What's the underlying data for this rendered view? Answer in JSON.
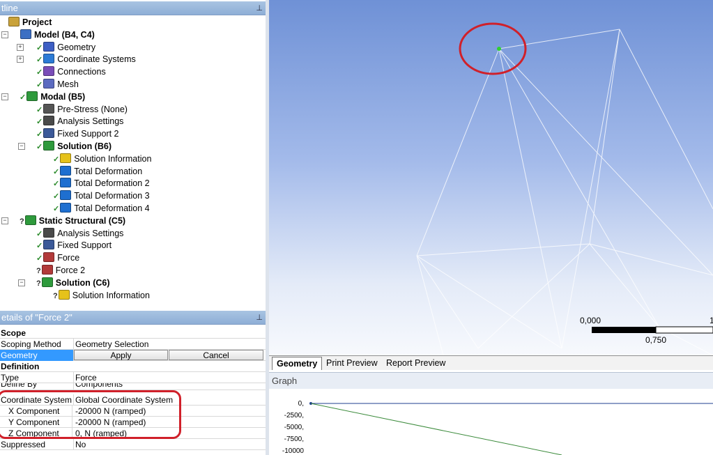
{
  "outline": {
    "title": "tline",
    "items": [
      {
        "label": "Project",
        "level": 0,
        "bold": true,
        "icon": "project-icon"
      },
      {
        "label": "Model (B4, C4)",
        "level": 1,
        "bold": true,
        "icon": "model-icon"
      },
      {
        "label": "Geometry",
        "level": 2,
        "icon": "geometry-icon"
      },
      {
        "label": "Coordinate Systems",
        "level": 2,
        "icon": "coordinate-icon"
      },
      {
        "label": "Connections",
        "level": 2,
        "icon": "connections-icon"
      },
      {
        "label": "Mesh",
        "level": 2,
        "icon": "mesh-icon"
      },
      {
        "label": "Modal (B5)",
        "level": 1,
        "bold": true,
        "icon": "modal-icon"
      },
      {
        "label": "Pre-Stress (None)",
        "level": 2,
        "icon": "prestress-icon"
      },
      {
        "label": "Analysis Settings",
        "level": 2,
        "icon": "analysis-settings-icon"
      },
      {
        "label": "Fixed Support 2",
        "level": 2,
        "icon": "fixed-support-icon"
      },
      {
        "label": "Solution (B6)",
        "level": 2,
        "bold": true,
        "icon": "solution-icon"
      },
      {
        "label": "Solution Information",
        "level": 3,
        "icon": "solution-info-icon"
      },
      {
        "label": "Total Deformation",
        "level": 3,
        "icon": "deformation-icon"
      },
      {
        "label": "Total Deformation 2",
        "level": 3,
        "icon": "deformation-icon"
      },
      {
        "label": "Total Deformation 3",
        "level": 3,
        "icon": "deformation-icon"
      },
      {
        "label": "Total Deformation 4",
        "level": 3,
        "icon": "deformation-icon"
      },
      {
        "label": "Static Structural (C5)",
        "level": 1,
        "bold": true,
        "icon": "static-structural-icon"
      },
      {
        "label": "Analysis Settings",
        "level": 2,
        "icon": "analysis-settings-icon"
      },
      {
        "label": "Fixed Support",
        "level": 2,
        "icon": "fixed-support-icon"
      },
      {
        "label": "Force",
        "level": 2,
        "icon": "force-icon"
      },
      {
        "label": "Force 2",
        "level": 2,
        "icon": "force-icon"
      },
      {
        "label": "Solution (C6)",
        "level": 2,
        "bold": true,
        "icon": "solution-icon"
      },
      {
        "label": "Solution Information",
        "level": 3,
        "icon": "solution-info-icon"
      }
    ]
  },
  "details": {
    "title": "etails of \"Force 2\"",
    "scope_header": "Scope",
    "scoping_method_key": "Scoping Method",
    "scoping_method_val": "Geometry Selection",
    "geometry_key": "Geometry",
    "apply_label": "Apply",
    "cancel_label": "Cancel",
    "definition_header": "Definition",
    "type_key": "Type",
    "type_val": "Force",
    "define_by_key": "Define By",
    "define_by_val": "Components",
    "coord_key": "Coordinate System",
    "coord_val": "Global Coordinate System",
    "x_key": "X Component",
    "x_val": "-20000 N  (ramped)",
    "y_key": "Y Component",
    "y_val": "-20000 N  (ramped)",
    "z_key": "Z Component",
    "z_val": "0, N  (ramped)",
    "suppressed_key": "Suppressed",
    "suppressed_val": "No"
  },
  "viewport": {
    "scale_left": "0,000",
    "scale_mid": "0,750",
    "scale_right": "1"
  },
  "tabs": {
    "geometry": "Geometry",
    "print_preview": "Print Preview",
    "report_preview": "Report Preview"
  },
  "graph": {
    "title": "Graph",
    "y_ticks": [
      "0,",
      "-2500,",
      "-5000,",
      "-7500,",
      "-10000"
    ]
  },
  "colors": {
    "annotation_red": "#d0202a",
    "graph_line": "#3a8a3a",
    "selected_blue": "#3399ff"
  }
}
